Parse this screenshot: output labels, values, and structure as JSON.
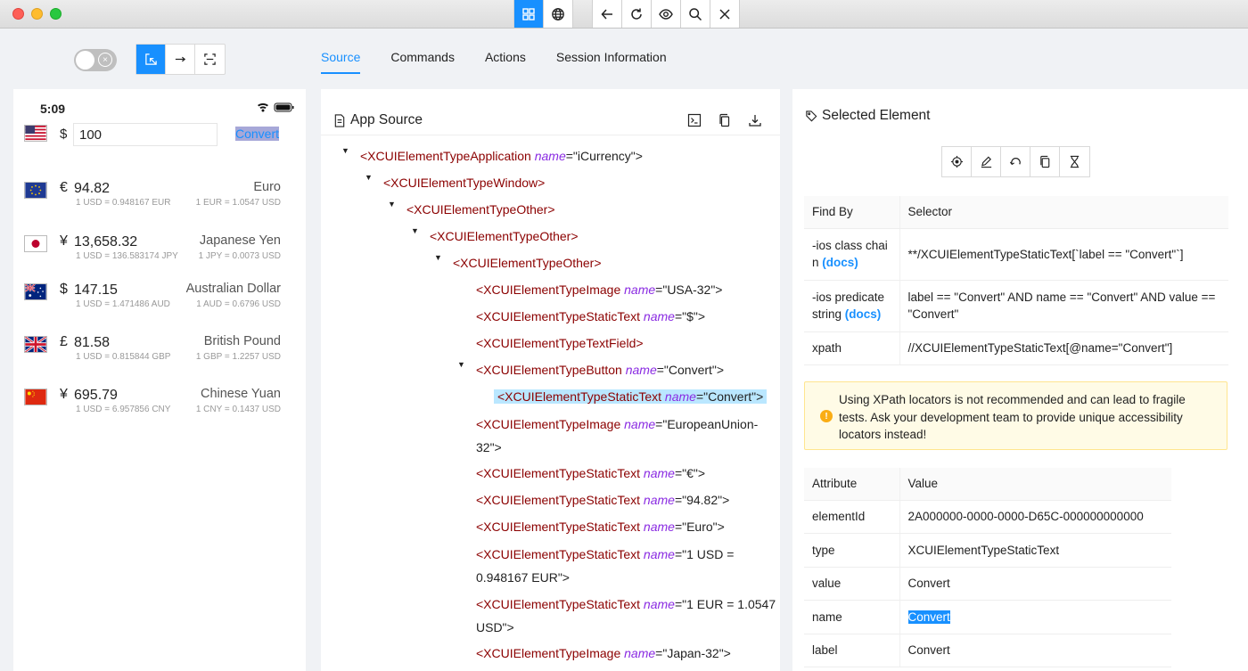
{
  "phone": {
    "time": "5:09",
    "currency_symbol": "$",
    "amount": "100",
    "convert_label": "Convert",
    "rows": [
      {
        "symbol": "€",
        "value": "94.82",
        "name": "Euro",
        "rate_from": "1 USD = 0.948167 EUR",
        "rate_to": "1 EUR = 1.0547 USD",
        "flag": "eu-flag-icon"
      },
      {
        "symbol": "¥",
        "value": "13,658.32",
        "name": "Japanese Yen",
        "rate_from": "1 USD = 136.583174 JPY",
        "rate_to": "1 JPY = 0.0073 USD",
        "flag": "japan-flag-icon"
      },
      {
        "symbol": "$",
        "value": "147.15",
        "name": "Australian Dollar",
        "rate_from": "1 USD = 1.471486 AUD",
        "rate_to": "1 AUD = 0.6796 USD",
        "flag": "australia-flag-icon"
      },
      {
        "symbol": "£",
        "value": "81.58",
        "name": "British Pound",
        "rate_from": "1 USD = 0.815844 GBP",
        "rate_to": "1 GBP = 1.2257 USD",
        "flag": "uk-flag-icon"
      },
      {
        "symbol": "¥",
        "value": "695.79",
        "name": "Chinese Yuan",
        "rate_from": "1 USD = 6.957856 CNY",
        "rate_to": "1 CNY = 0.1437 USD",
        "flag": "china-flag-icon"
      }
    ]
  },
  "tabs": [
    "Source",
    "Commands",
    "Actions",
    "Session Information"
  ],
  "source": {
    "title": "App Source",
    "tree": [
      {
        "tag": "<XCUIElementTypeApplication",
        "attr": "name",
        "val": "=\"iCurrency\">",
        "caret": true
      },
      {
        "tag": "<XCUIElementTypeWindow>",
        "attr": "",
        "val": "",
        "caret": true
      },
      {
        "tag": "<XCUIElementTypeOther>",
        "attr": "",
        "val": "",
        "caret": true
      },
      {
        "tag": "<XCUIElementTypeOther>",
        "attr": "",
        "val": "",
        "caret": true
      },
      {
        "tag": "<XCUIElementTypeOther>",
        "attr": "",
        "val": "",
        "caret": true
      },
      {
        "tag": "<XCUIElementTypeImage",
        "attr": "name",
        "val": "=\"USA-32\">",
        "caret": false
      },
      {
        "tag": "<XCUIElementTypeStaticText",
        "attr": "name",
        "val": "=\"$\">",
        "caret": false
      },
      {
        "tag": "<XCUIElementTypeTextField>",
        "attr": "",
        "val": "",
        "caret": false
      },
      {
        "tag": "<XCUIElementTypeButton",
        "attr": "name",
        "val": "=\"Convert\">",
        "caret": true
      },
      {
        "tag": "<XCUIElementTypeStaticText",
        "attr": "name",
        "val": "=\"Convert\">",
        "caret": false,
        "selected": true
      },
      {
        "tag": "<XCUIElementTypeImage",
        "attr": "name",
        "val": "=\"EuropeanUnion-",
        "val2": "32\">",
        "caret": false
      },
      {
        "tag": "<XCUIElementTypeStaticText",
        "attr": "name",
        "val": "=\"€\">",
        "caret": false
      },
      {
        "tag": "<XCUIElementTypeStaticText",
        "attr": "name",
        "val": "=\"94.82\">",
        "caret": false
      },
      {
        "tag": "<XCUIElementTypeStaticText",
        "attr": "name",
        "val": "=\"Euro\">",
        "caret": false
      },
      {
        "tag": "<XCUIElementTypeStaticText",
        "attr": "name",
        "val": "=\"1 USD =",
        "val2": "0.948167 EUR\">",
        "caret": false
      },
      {
        "tag": "<XCUIElementTypeStaticText",
        "attr": "name",
        "val": "=\"1 EUR = 1.0547",
        "val2": "USD\">",
        "caret": false
      },
      {
        "tag": "<XCUIElementTypeImage",
        "attr": "name",
        "val": "=\"Japan-32\">",
        "caret": false
      }
    ]
  },
  "selected": {
    "title": "Selected Element",
    "find_by_header": "Find By",
    "selector_header": "Selector",
    "selectors": [
      {
        "by": "-ios class chai",
        "by2": "n",
        "docs": "(docs)",
        "value": "**/XCUIElementTypeStaticText[`label == \"Convert\"`]"
      },
      {
        "by": "-ios predicate",
        "by2": "string",
        "docs": "(docs)",
        "value": "label == \"Convert\" AND name == \"Convert\" AND value ==",
        "value2": "\"Convert\""
      },
      {
        "by": "xpath",
        "by2": "",
        "docs": "",
        "value": "//XCUIElementTypeStaticText[@name=\"Convert\"]"
      }
    ],
    "warning": "Using XPath locators is not recommended and can lead to fragile tests. Ask your development team to provide unique accessibility locators instead!",
    "attr_header": "Attribute",
    "value_header": "Value",
    "attributes": [
      {
        "name": "elementId",
        "value": "2A000000-0000-0000-D65C-000000000000"
      },
      {
        "name": "type",
        "value": "XCUIElementTypeStaticText"
      },
      {
        "name": "value",
        "value": "Convert"
      },
      {
        "name": "name",
        "value": "Convert",
        "selected": true
      },
      {
        "name": "label",
        "value": "Convert"
      }
    ]
  },
  "colors": {
    "accent": "#1890ff",
    "tag": "#8b0000",
    "attr": "#8a2be2"
  }
}
